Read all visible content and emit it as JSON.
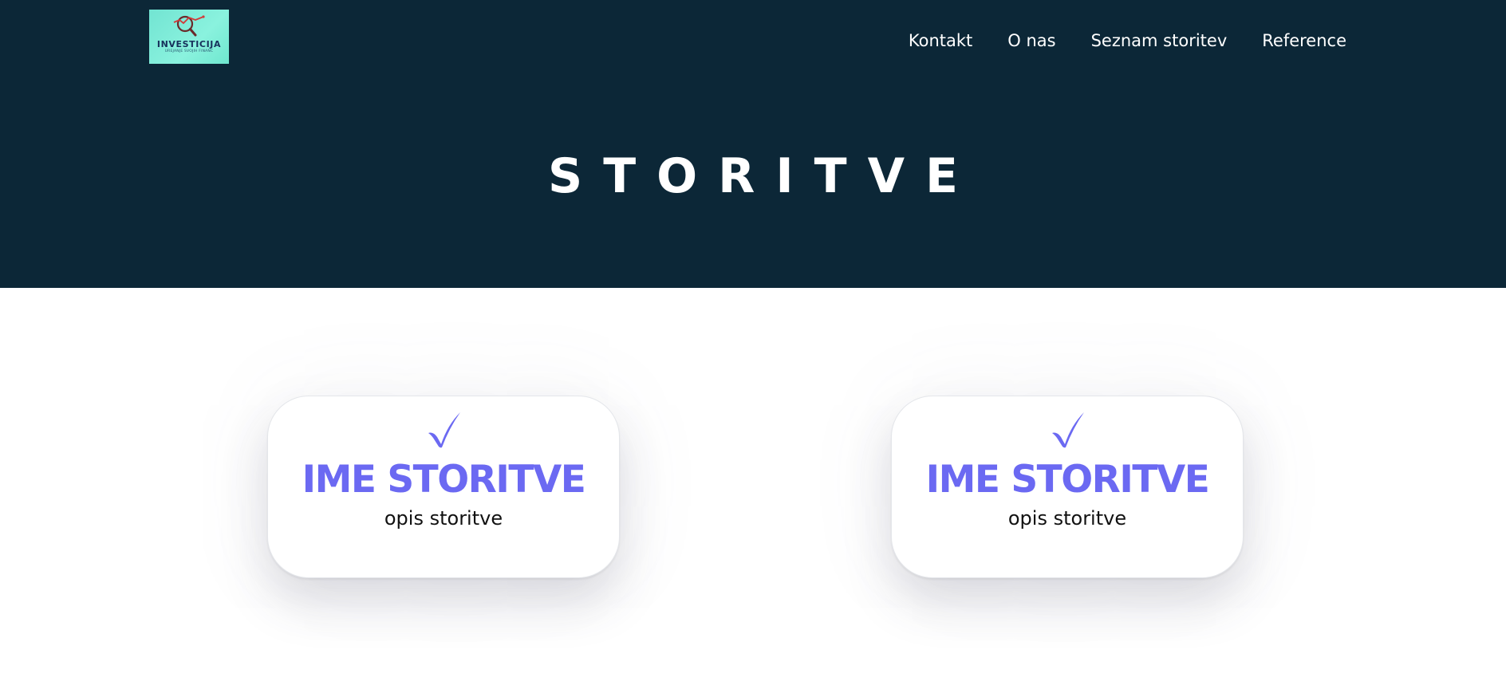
{
  "logo": {
    "name": "INVESTICIJA",
    "tagline": "UREJANJE SVOJIH FINANC",
    "icon": "magnifier-chart-icon",
    "background": "#7eebd8"
  },
  "nav": {
    "items": [
      {
        "label": "Kontakt"
      },
      {
        "label": "O nas"
      },
      {
        "label": "Seznam storitev"
      },
      {
        "label": "Reference"
      }
    ]
  },
  "hero": {
    "title": "STORITVE",
    "background": "#0c2737"
  },
  "services": [
    {
      "icon": "checkmark-icon",
      "title": "IME STORITVE",
      "description": "opis storitve"
    },
    {
      "icon": "checkmark-icon",
      "title": "IME STORITVE",
      "description": "opis storitve"
    }
  ],
  "colors": {
    "accent": "#6b69f2",
    "header_text": "#ffffff",
    "body_text": "#111111"
  }
}
